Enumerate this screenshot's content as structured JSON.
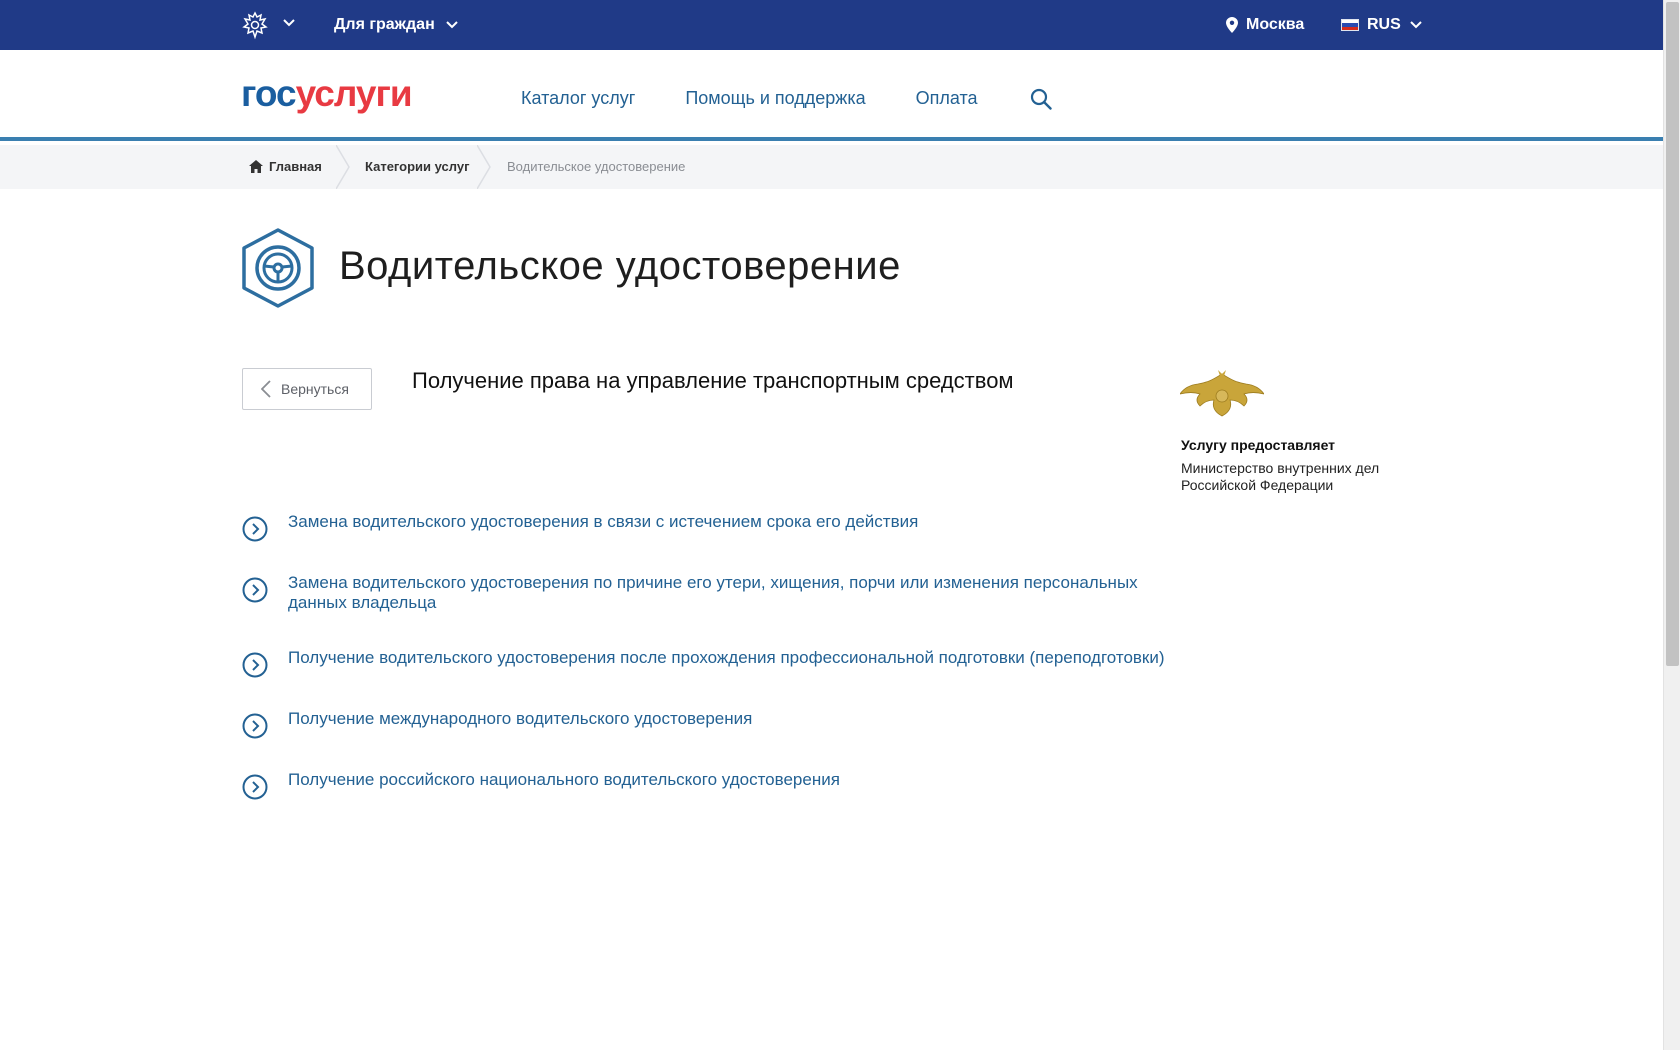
{
  "topbar": {
    "emblem_icon": "russian-emblem-icon",
    "audience_label": "Для граждан",
    "location_label": "Москва",
    "language_label": "RUS",
    "bg_color": "#203a87"
  },
  "header": {
    "logo_part1": "гос",
    "logo_part2": "услуги",
    "nav": [
      "Каталог услуг",
      "Помощь и поддержка",
      "Оплата"
    ],
    "search_icon": "search-icon",
    "accent": "#3a7fb0"
  },
  "breadcrumbs": {
    "home": "Главная",
    "category": "Категории услуг",
    "current": "Водительское удостоверение"
  },
  "page": {
    "title": "Водительское удостоверение",
    "title_icon": "steering-wheel-icon",
    "back_label": "Вернуться",
    "section_title": "Получение права на управление транспортным средством"
  },
  "links": [
    {
      "text": "Замена водительского удостоверения в связи с истечением срока его действия"
    },
    {
      "text": "Замена водительского удостоверения по причине его утери, хищения, порчи или изменения персональных данных владельца"
    },
    {
      "text": "Получение водительского удостоверения после прохождения профессиональной подготовки (переподготовки)"
    },
    {
      "text": "Получение международного водительского удостоверения"
    },
    {
      "text": "Получение российского национального водительского удостоверения"
    }
  ],
  "provider": {
    "label": "Услугу предоставляет",
    "name": "Министерство внутренних дел Российской Федерации",
    "emblem_icon": "mvd-emblem-icon"
  },
  "colors": {
    "link": "#236193",
    "logo_blue": "#1a5ea0",
    "logo_red": "#e83a42"
  }
}
